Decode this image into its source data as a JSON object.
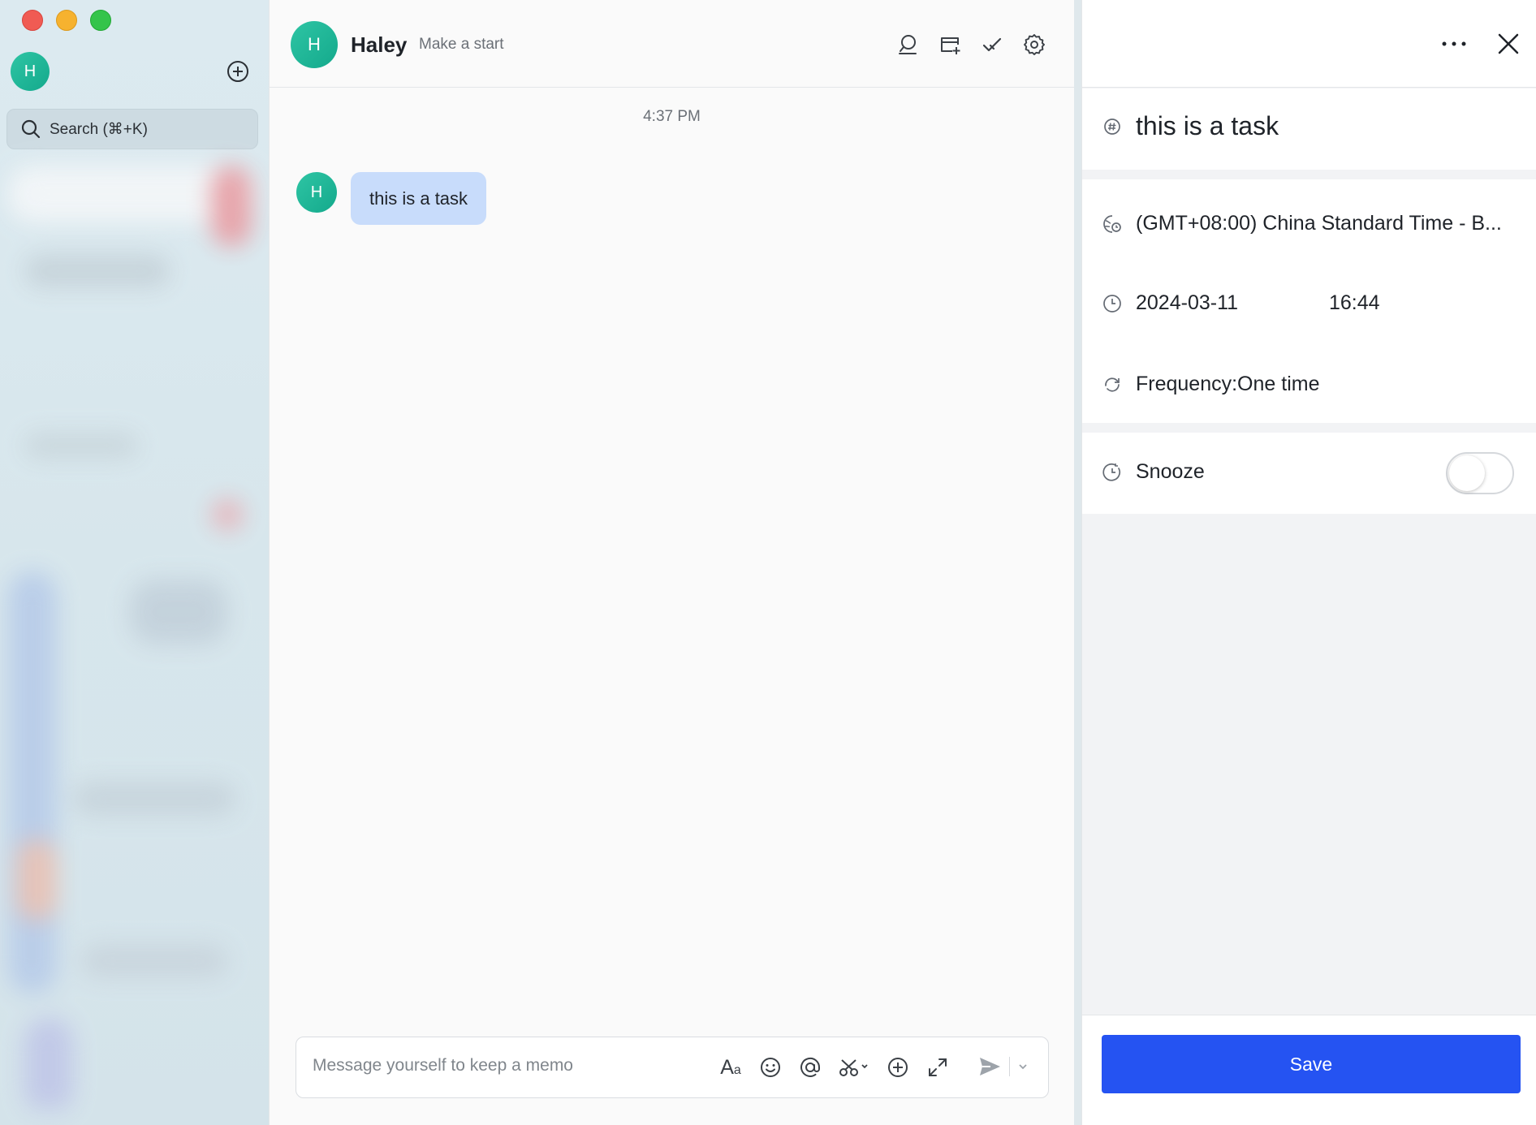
{
  "sidebar": {
    "avatar_letter": "H",
    "search_placeholder": "Search (⌘+K)",
    "icons": [
      "plus-circle-icon",
      "search-icon"
    ]
  },
  "chat": {
    "contact": {
      "avatar_letter": "H",
      "name": "Haley",
      "status": "Make a start"
    },
    "header_icons": [
      "chat-search-icon",
      "add-tab-icon",
      "checkmark-icon",
      "settings-gear-icon"
    ],
    "timestamp": "4:37 PM",
    "messages": [
      {
        "avatar_letter": "H",
        "text": "this is a task"
      }
    ],
    "composer": {
      "placeholder": "Message yourself to keep a memo",
      "format_label": "A",
      "format_small": "a",
      "tools": [
        "format-text-icon",
        "emoji-icon",
        "mention-icon",
        "scissors-icon",
        "plus-circle-icon",
        "expand-icon",
        "send-icon",
        "chevron-down-icon"
      ]
    }
  },
  "task_panel": {
    "title": "this is a task",
    "timezone": "(GMT+08:00) China Standard Time - B...",
    "date": "2024-03-11",
    "time": "16:44",
    "frequency": "Frequency:One time",
    "snooze_label": "Snooze",
    "snooze_enabled": false,
    "save_label": "Save",
    "colors": {
      "save_button": "#2553f2",
      "avatar": "#1fb898",
      "bubble": "#c8dcfb"
    }
  }
}
